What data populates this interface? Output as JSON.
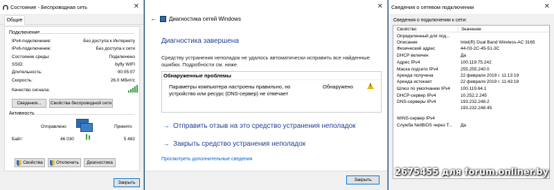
{
  "status_window": {
    "title": "Состояние - Беспроводная сеть",
    "tab": "Общие",
    "connection_group": "Подключение",
    "connection_rows": [
      {
        "label": "IPv4-подключение:",
        "value": "Без доступа к Интернету"
      },
      {
        "label": "IPv6-подключение:",
        "value": "Без доступа к сети"
      },
      {
        "label": "Состояние среды:",
        "value": "Подключено"
      },
      {
        "label": "SSID:",
        "value": "byfly WIFI"
      },
      {
        "label": "Длительность:",
        "value": "00:05:07"
      },
      {
        "label": "Скорость:",
        "value": "26.0 Мбит/с"
      }
    ],
    "signal_label": "Качество сигнала:",
    "signal_bars": 5,
    "details_button": "Сведения...",
    "wireless_props_button": "Свойства беспроводной сети",
    "activity_group": "Активность",
    "sent_label": "Отправлено",
    "received_label": "Принято",
    "bytes_label": "Байт:",
    "bytes_sent": "46 030",
    "bytes_received": "5 482",
    "properties_button": "Свойства",
    "disable_button": "Отключить",
    "diagnose_button": "Диагностика",
    "close_button": "Закрыть"
  },
  "diag_window": {
    "title": "Диагностика сетей Windows",
    "heading": "Диагностика завершена",
    "paragraph": "Средству устранения неполадок не удалось автоматически исправить все найденные ошибки. Подробности см. ниже.",
    "problems_header": "Обнаруженные проблемы",
    "problem_text": "Параметры компьютера настроены правильно, но устройство или ресурс (DNS-сервер) не отвечает",
    "problem_status": "Обнаружено",
    "feedback_link": "Отправить отзыв на это средство устранения неполадок",
    "close_tool_link": "Закрыть средство устранения неполадок",
    "details_link": "Просмотреть дополнительные сведения",
    "close_button": "Закрыть"
  },
  "details_window": {
    "title": "Сведения о сетевом подключении",
    "subtitle": "Сведения о подключении к сети:",
    "col_property": "Свойство",
    "col_value": "Значение",
    "rows": [
      {
        "name": "Определенный для под...",
        "value": ""
      },
      {
        "name": "Описание",
        "value": "Intel(R) Dual Band Wireless-AC 3165"
      },
      {
        "name": "Физический адрес",
        "value": "44-03-2C-45-51-3C"
      },
      {
        "name": "DHCP включен",
        "value": "Да"
      },
      {
        "name": "Адрес IPv4",
        "value": "100.119.75.242"
      },
      {
        "name": "Маска подсети IPv4",
        "value": "255.255.240.0"
      },
      {
        "name": "Аренда получена",
        "value": "22 февраля 2019 г. 11:13:19"
      },
      {
        "name": "Аренда истекает",
        "value": "22 февраля 2019 г. 11:43:18"
      },
      {
        "name": "Шлюз по умолчанию IPv4",
        "value": "100.119.64.1"
      },
      {
        "name": "DHCP-сервер IPv4",
        "value": "10.252.2.245"
      },
      {
        "name": "DNS-серверы IPv4",
        "value": "193.232.248.2"
      },
      {
        "name": "",
        "value": "193.232.248.45"
      },
      {
        "name": "WINS-сервер IPv4",
        "value": ""
      },
      {
        "name": "Служба NetBIOS через Т...",
        "value": "Да"
      }
    ]
  },
  "watermark": "2675455 для forum.onliner.by"
}
